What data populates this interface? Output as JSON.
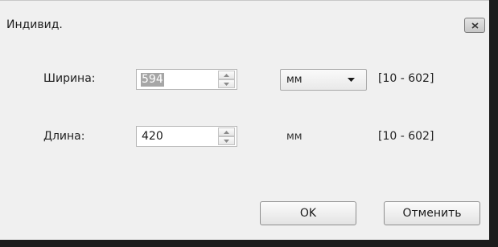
{
  "window": {
    "title": "Индивид.",
    "close_icon": "close-icon"
  },
  "fields": {
    "width": {
      "label": "Ширина:",
      "value": "594",
      "unit": "мм",
      "range": "[10 - 602]"
    },
    "length": {
      "label": "Длина:",
      "value": "420",
      "unit": "мм",
      "range": "[10 - 602]"
    }
  },
  "buttons": {
    "ok": "OK",
    "cancel": "Отменить"
  }
}
